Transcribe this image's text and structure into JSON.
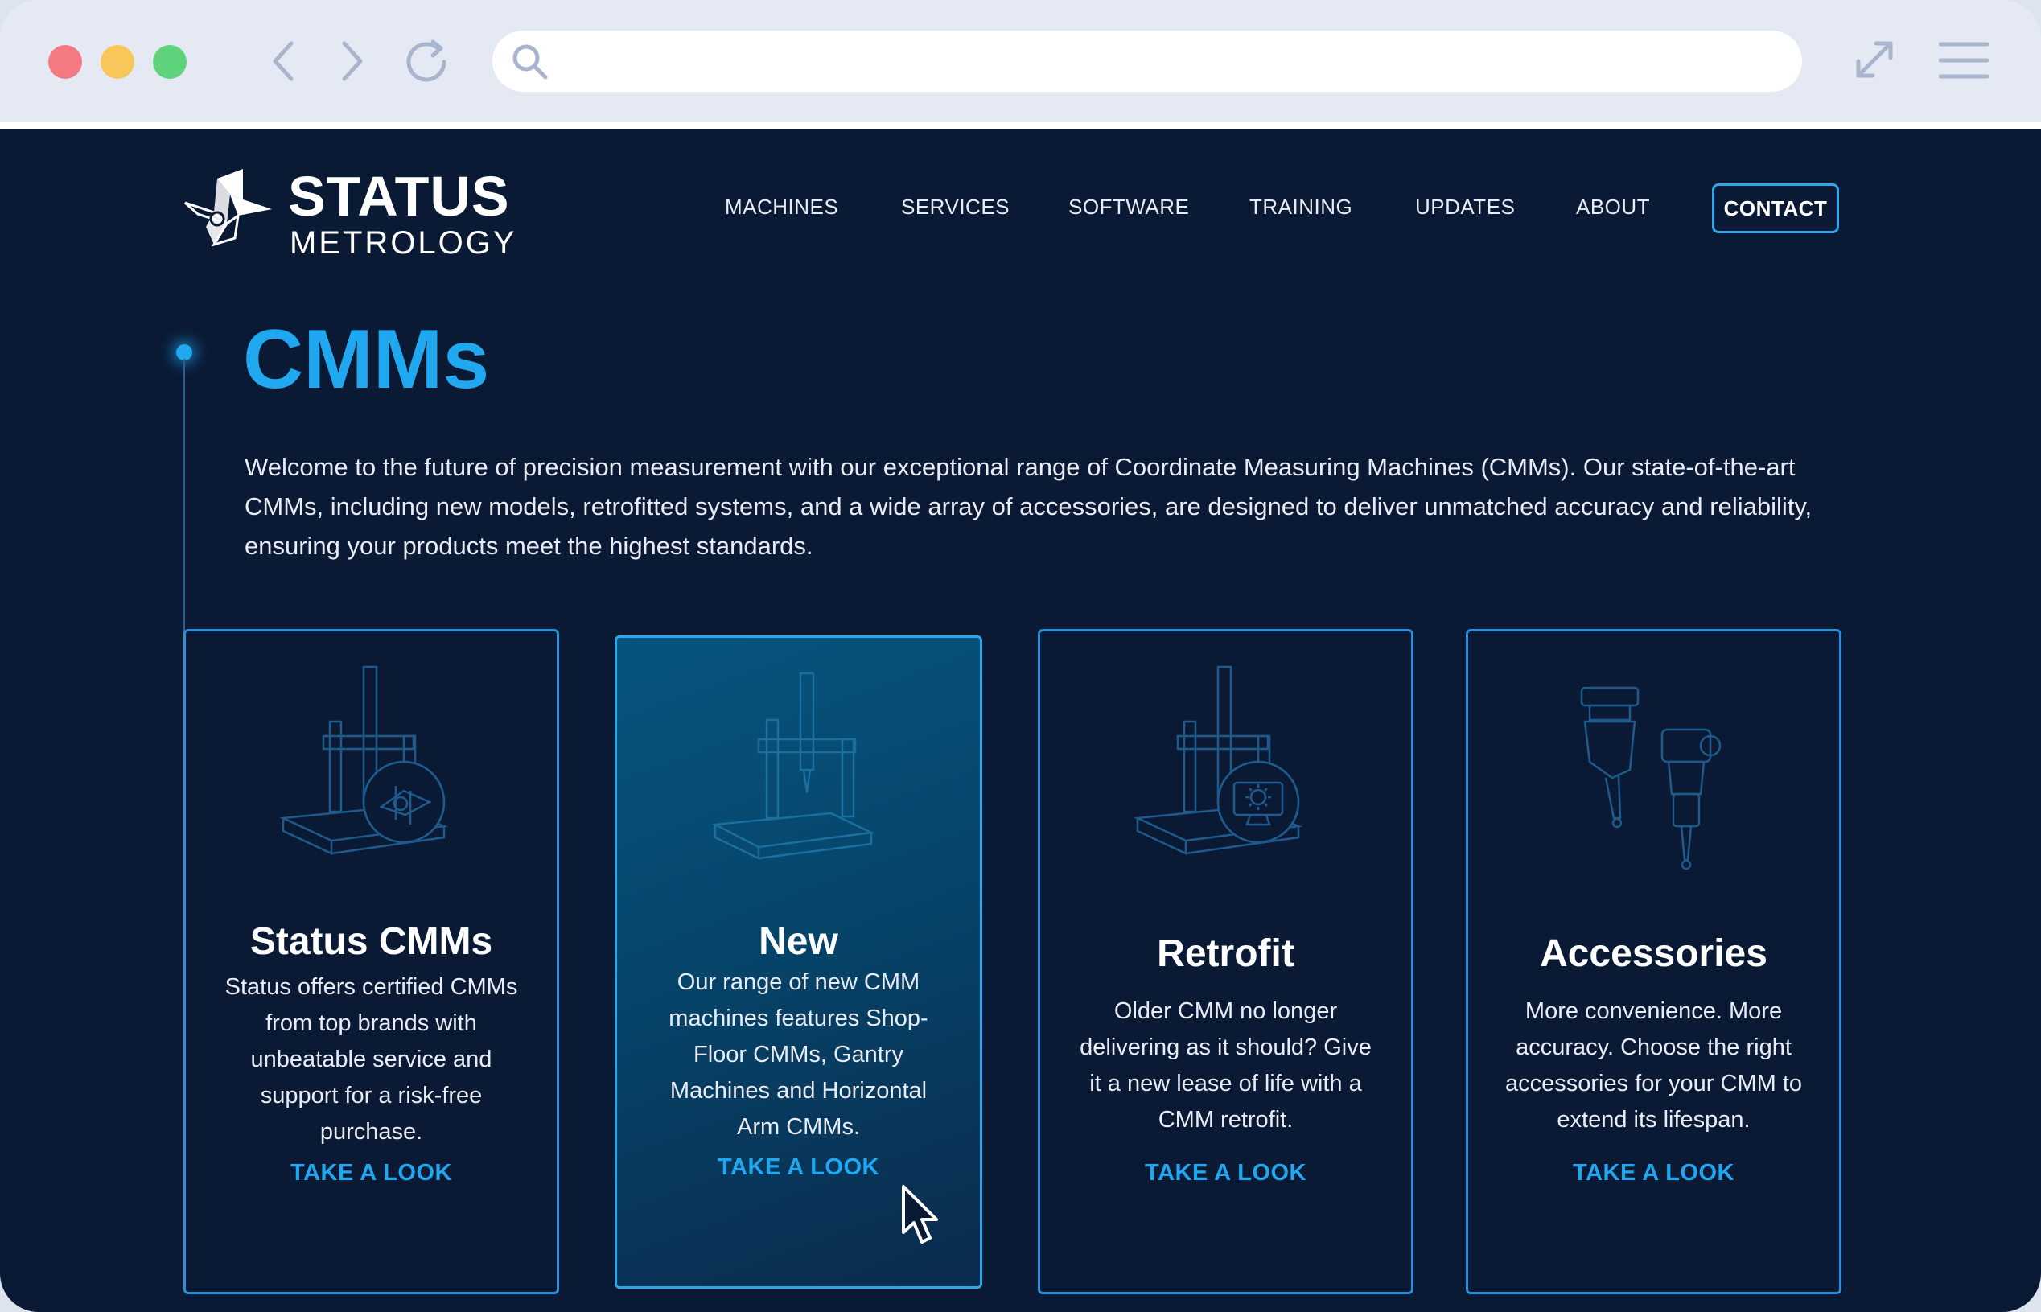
{
  "browser": {
    "address_value": "",
    "address_placeholder": ""
  },
  "brand": {
    "name_top": "STATUS",
    "name_bottom": "METROLOGY"
  },
  "nav": {
    "items": [
      "MACHINES",
      "SERVICES",
      "SOFTWARE",
      "TRAINING",
      "UPDATES",
      "ABOUT"
    ],
    "contact_label": "CONTACT"
  },
  "hero": {
    "title": "CMMs",
    "intro": "Welcome to the future of precision measurement with our exceptional range of Coordinate Measuring Machines (CMMs). Our state-of-the-art CMMs, including new models, retrofitted systems, and a wide array of accessories, are designed to deliver unmatched accuracy and reliability, ensuring your products meet the highest standards."
  },
  "cards": [
    {
      "title": "Status CMMs",
      "description": "Status offers certified CMMs from top brands with unbeatable service and support for a risk-free purchase.",
      "cta": "TAKE A LOOK",
      "icon": "cmm-certified-icon"
    },
    {
      "title": "New",
      "description": "Our range of new CMM machines features Shop-Floor CMMs, Gantry Machines and Horizontal Arm CMMs.",
      "cta": "TAKE A LOOK",
      "icon": "cmm-machine-icon"
    },
    {
      "title": "Retrofit",
      "description": "Older CMM no longer delivering as it should? Give it a new lease of life with a CMM retrofit.",
      "cta": "TAKE A LOOK",
      "icon": "cmm-retrofit-icon"
    },
    {
      "title": "Accessories",
      "description": "More convenience. More accuracy. Choose the right accessories for your CMM to extend its lifespan.",
      "cta": "TAKE A LOOK",
      "icon": "probe-accessories-icon"
    }
  ],
  "colors": {
    "page_background": "#0a1a35",
    "accent": "#1fa7ef",
    "card_border": "#2a8fd6",
    "highlight_card": "#06557e",
    "text": "#e7ecf5"
  }
}
